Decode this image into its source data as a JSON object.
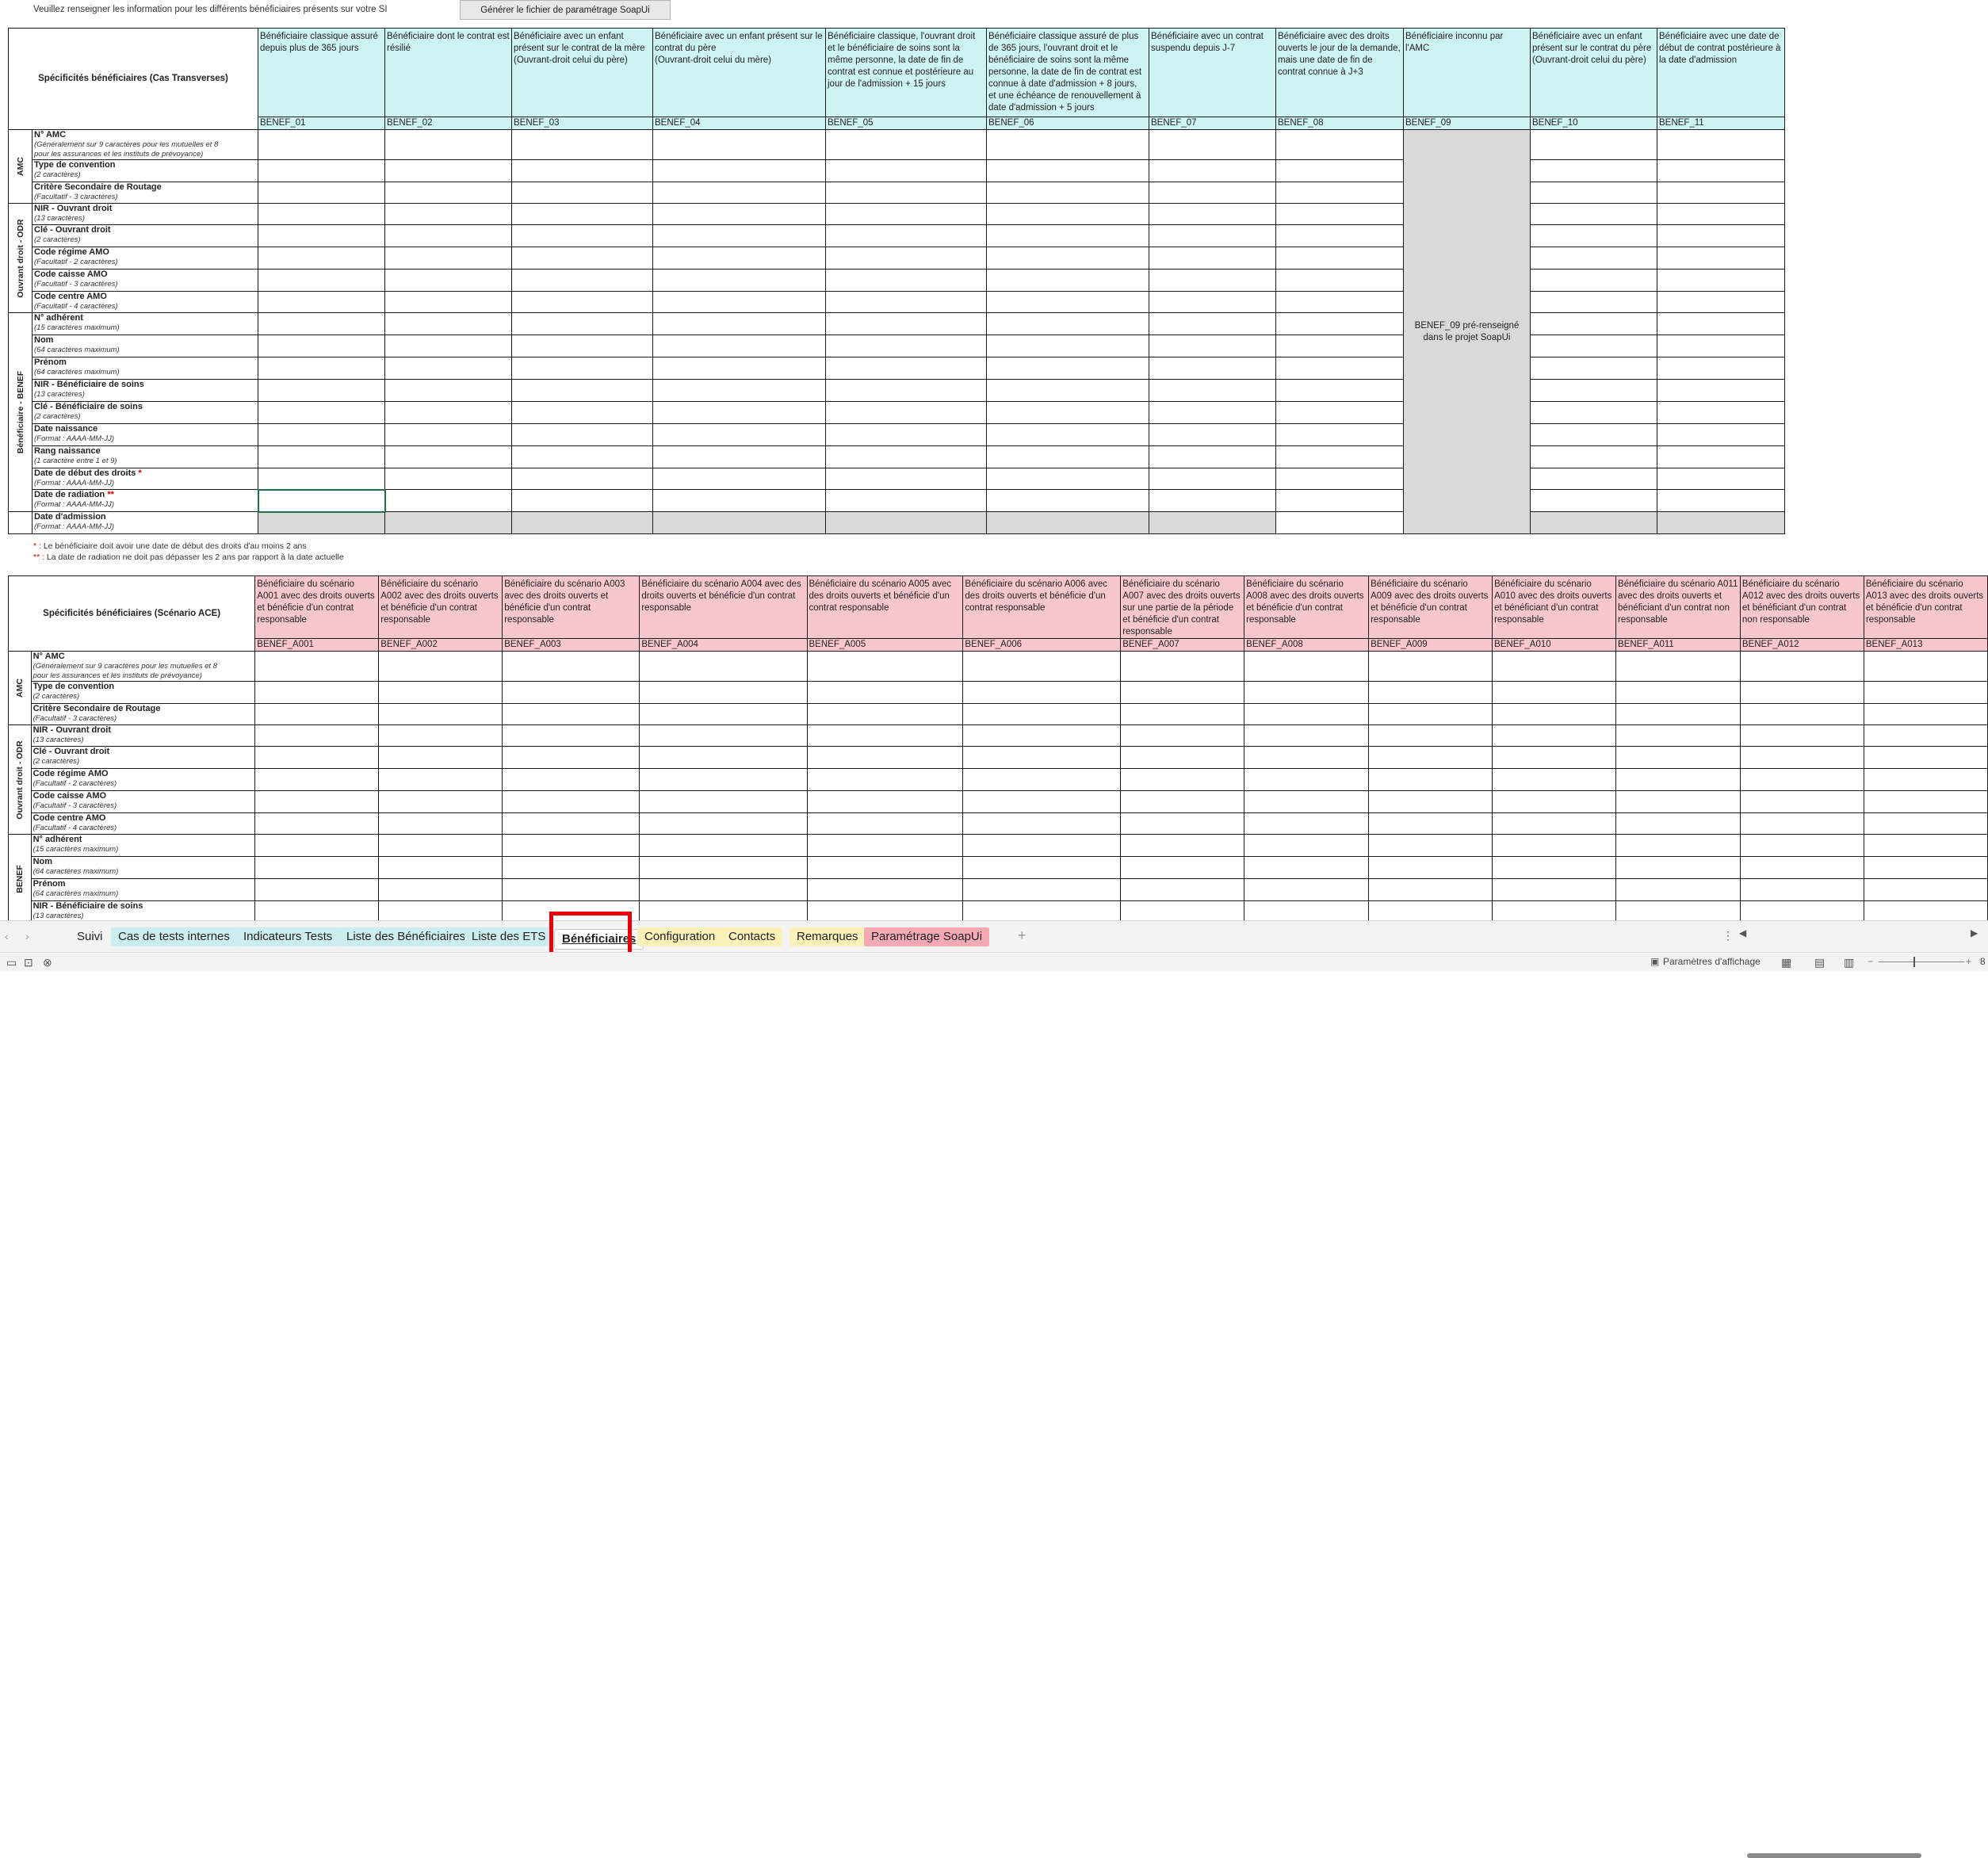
{
  "top": {
    "note": "Veuillez renseigner les information pour les différents bénéficiaires présents sur votre SI",
    "button": "Générer le fichier de paramétrage SoapUi"
  },
  "table1": {
    "title": "Spécificités bénéficiaires (Cas Transverses)",
    "columns": [
      {
        "desc": "Bénéficiaire classique assuré depuis plus de 365 jours",
        "code": "BENEF_01"
      },
      {
        "desc": "Bénéficiaire dont le contrat est résilié",
        "code": "BENEF_02"
      },
      {
        "desc": "Bénéficiaire avec un enfant présent sur le contrat de la mère\n(Ouvrant-droit celui du père)",
        "code": "BENEF_03"
      },
      {
        "desc": "Bénéficiaire avec un enfant présent sur le contrat du père\n(Ouvrant-droit celui du mère)",
        "code": "BENEF_04"
      },
      {
        "desc": "Bénéficiaire classique, l'ouvrant droit et le bénéficiaire de soins sont la même personne, la date de fin de contrat est connue et postérieure au jour de l'admission + 15 jours",
        "code": "BENEF_05"
      },
      {
        "desc": "Bénéficiaire classique assuré de plus de 365 jours, l'ouvrant droit et le bénéficiaire de soins sont la même personne, la date de fin de contrat est connue à date d'admission + 8 jours, et une échéance de renouvellement à date d'admission + 5 jours",
        "code": "BENEF_06"
      },
      {
        "desc": "Bénéficiaire avec un contrat suspendu depuis J-7",
        "code": "BENEF_07"
      },
      {
        "desc": "Bénéficiaire avec des droits ouverts le jour de la demande, mais une date de fin de contrat connue à J+3",
        "code": "BENEF_08"
      },
      {
        "desc": "Bénéficiaire inconnu par l'AMC",
        "code": "BENEF_09"
      },
      {
        "desc": "Bénéficiaire avec un enfant présent sur le contrat du père\n(Ouvrant-droit celui du père)",
        "code": "BENEF_10"
      },
      {
        "desc": "Bénéficiaire avec une date de début de contrat postérieure à la date d'admission",
        "code": "BENEF_11"
      }
    ],
    "merged_note": "BENEF_09 pré-renseigné dans le projet SoapUi"
  },
  "groups": {
    "amc": "AMC",
    "odr": "Ouvrant droit - ODR",
    "benef": "Bénéficiaire - BENEF"
  },
  "rows": [
    {
      "label": "N° AMC",
      "sub": "(Généralement sur 9 caractères pour les mutuelles et 8",
      "sub2": "pour les assurances et les instituts de prévoyance)"
    },
    {
      "label": "Type de convention",
      "sub": "(2 caractères)"
    },
    {
      "label": "Critère Secondaire de Routage",
      "sub": "(Facultatif - 3 caractères)"
    },
    {
      "label": "NIR - Ouvrant droit",
      "sub": "(13 caractères)"
    },
    {
      "label": "Clé - Ouvrant droit",
      "sub": "(2 caractères)"
    },
    {
      "label": "Code régime AMO",
      "sub": "(Facultatif - 2 caractères)"
    },
    {
      "label": "Code caisse AMO",
      "sub": "(Facultatif - 3 caractères)"
    },
    {
      "label": "Code centre AMO",
      "sub": "(Facultatif - 4 caractères)"
    },
    {
      "label": "N° adhérent",
      "sub": "(15 caractères maximum)"
    },
    {
      "label": "Nom",
      "sub": "(64 caractères maximum)"
    },
    {
      "label": "Prénom",
      "sub": "(64 caractères maximum)"
    },
    {
      "label": "NIR - Bénéficiaire de soins",
      "sub": "(13 caractères)"
    },
    {
      "label": "Clé - Bénéficiaire de soins",
      "sub": "(2 caractères)"
    },
    {
      "label": "Date naissance",
      "sub": "(Format : AAAA-MM-JJ)"
    },
    {
      "label": "Rang naissance",
      "sub": "(1 caractère entre 1 et 9)"
    },
    {
      "label": "Date de début des droits",
      "star": "*",
      "sub": "(Format : AAAA-MM-JJ)"
    },
    {
      "label": "Date de radiation",
      "star": "**",
      "sub": "(Format : AAAA-MM-JJ)"
    },
    {
      "label": "Date d'admission",
      "sub": "(Format : AAAA-MM-JJ)"
    }
  ],
  "footnotes": {
    "f1_star": "* :",
    "f1": " Le bénéficiaire doit avoir une date de début des droits d'au moins 2 ans",
    "f2_star": "** :",
    "f2": " La date de radiation ne doit pas dépasser les 2 ans par rapport à la date actuelle"
  },
  "table2": {
    "title": "Spécificités bénéficiaires (Scénario ACE)",
    "columns": [
      {
        "desc": "Bénéficiaire du scénario A001 avec des droits ouverts et bénéficie d'un contrat responsable",
        "code": "BENEF_A001"
      },
      {
        "desc": "Bénéficiaire du scénario A002 avec des droits ouverts et bénéficie d'un contrat responsable",
        "code": "BENEF_A002"
      },
      {
        "desc": "Bénéficiaire du scénario A003 avec des droits ouverts et bénéficie d'un contrat responsable",
        "code": "BENEF_A003"
      },
      {
        "desc": "Bénéficiaire du scénario A004 avec des droits ouverts et bénéficie d'un contrat responsable",
        "code": "BENEF_A004"
      },
      {
        "desc": "Bénéficiaire du scénario A005 avec des droits ouverts et bénéficie d'un contrat responsable",
        "code": "BENEF_A005"
      },
      {
        "desc": "Bénéficiaire du scénario A006 avec des droits ouverts et bénéficie d'un contrat responsable",
        "code": "BENEF_A006"
      },
      {
        "desc": "Bénéficiaire du scénario A007 avec des droits ouverts sur une partie de la période et bénéficie d'un contrat responsable",
        "code": "BENEF_A007"
      },
      {
        "desc": "Bénéficiaire du scénario A008 avec des droits ouverts et bénéficie d'un contrat responsable",
        "code": "BENEF_A008"
      },
      {
        "desc": "Bénéficiaire du scénario A009 avec des droits ouverts et bénéficie d'un contrat responsable",
        "code": "BENEF_A009"
      },
      {
        "desc": "Bénéficiaire du scénario A010 avec des droits ouverts et bénéficiant d'un contrat responsable",
        "code": "BENEF_A010"
      },
      {
        "desc": "Bénéficiaire du scénario A011 avec des droits ouverts et bénéficiant d'un contrat non responsable",
        "code": "BENEF_A011"
      },
      {
        "desc": "Bénéficiaire du scénario A012 avec des droits ouverts et bénéficiant d'un contrat non responsable",
        "code": "BENEF_A012"
      },
      {
        "desc": "Bénéficiaire du scénario A013 avec des droits ouverts et bénéficie d'un contrat responsable",
        "code": "BENEF_A013"
      }
    ],
    "visible_rows": 12,
    "partial_label": "NIR - Bénéficiaire de soins",
    "group_cut": "BENEF"
  },
  "tabs": [
    {
      "label": "Suivi",
      "style": "plain"
    },
    {
      "label": "Cas de tests internes",
      "style": "teal"
    },
    {
      "label": "Indicateurs Tests",
      "style": "teal"
    },
    {
      "label": "Liste des Bénéficiaires",
      "style": "teal"
    },
    {
      "label": "Liste des ETS",
      "style": "teal"
    },
    {
      "label": "Bénéficiaires",
      "style": "active"
    },
    {
      "label": "Configuration",
      "style": "yellow"
    },
    {
      "label": "Contacts",
      "style": "yellow"
    },
    {
      "label": "Remarques",
      "style": "yellow"
    },
    {
      "label": "Paramétrage SoapUi",
      "style": "rose"
    }
  ],
  "tabbar": {
    "add": "+",
    "more": "⋮",
    "prev": "‹",
    "next": "›"
  },
  "statusbar": {
    "display_settings": "Paramètres d'affichage",
    "zoom": "8"
  }
}
